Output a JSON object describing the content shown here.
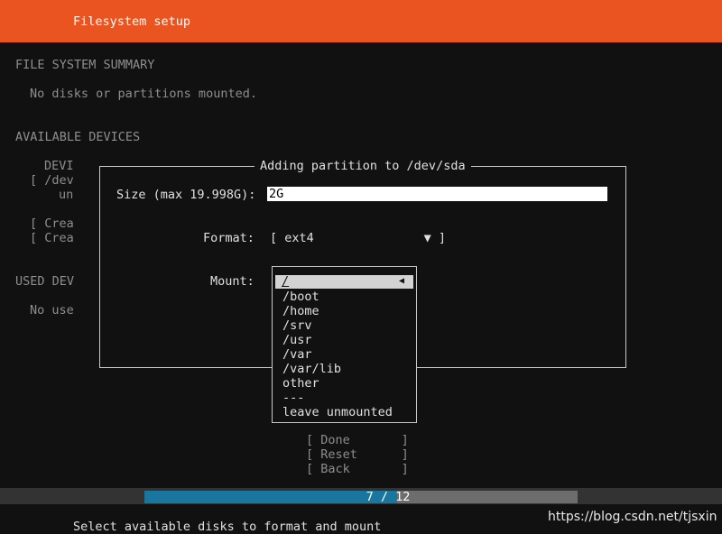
{
  "header": {
    "title": "Filesystem setup",
    "color": "#e95420"
  },
  "summary": {
    "heading": "FILE SYSTEM SUMMARY",
    "empty_text": "No disks or partitions mounted."
  },
  "available": {
    "heading": "AVAILABLE DEVICES",
    "col_head": "DEVI",
    "device_line": "[ /dev",
    "device_sub": "un",
    "create1": "[ Crea",
    "create2": "[ Crea"
  },
  "used": {
    "heading": "USED DEV",
    "empty_text": "No use"
  },
  "dialog": {
    "title": "Adding partition to /dev/sda",
    "size_label": "Size (max 19.998G):",
    "size_value": "2G",
    "format_label": "Format:",
    "format_value": "[ ext4               ▼ ]",
    "mount_label": "Mount:"
  },
  "mount_options": {
    "selected": "/",
    "items": [
      "/boot",
      "/home",
      "/srv",
      "/usr",
      "/var",
      "/var/lib",
      "other",
      "---",
      "leave unmounted"
    ]
  },
  "buttons": {
    "done": "[ Done       ]",
    "reset": "[ Reset      ]",
    "back": "[ Back       ]"
  },
  "progress": {
    "text": "7 / 12",
    "current": 7,
    "total": 12
  },
  "footer": {
    "hint": "Select available disks to format and mount"
  },
  "watermark": "https://blog.csdn.net/tjsxin"
}
